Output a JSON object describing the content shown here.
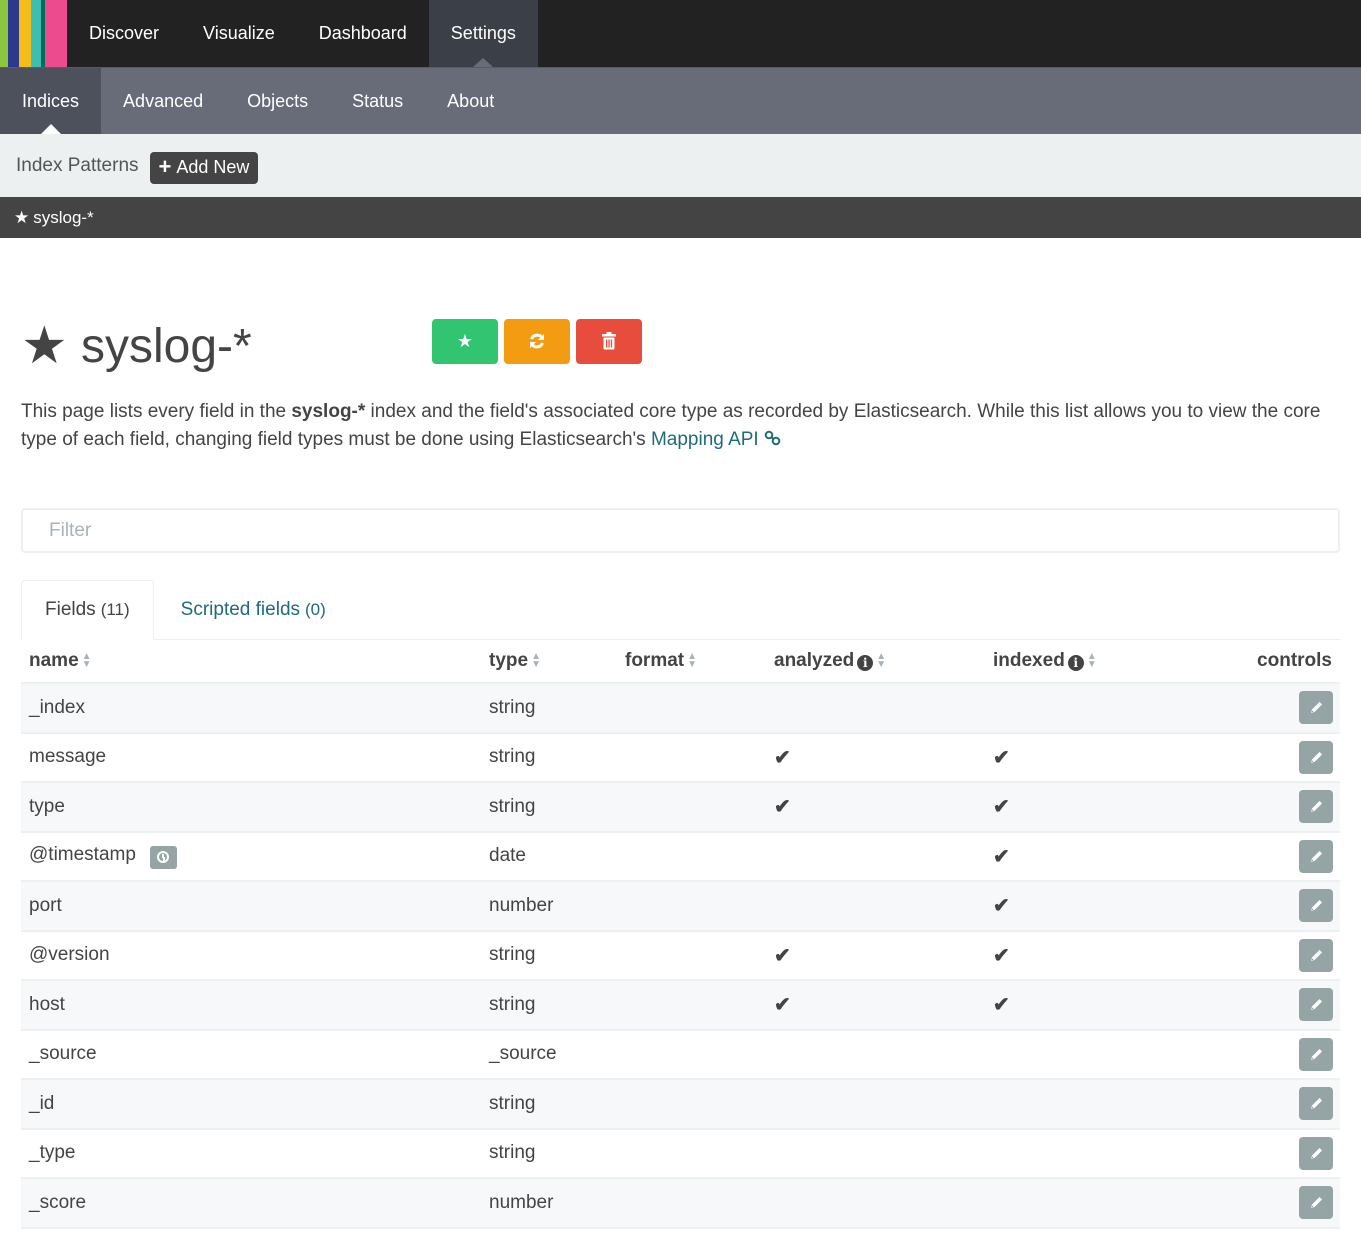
{
  "logo": {
    "colors": [
      "#8cc63f",
      "#2b3a8c",
      "#f3bd19",
      "#3ebeb0",
      "#006b5b",
      "#ec4b8e"
    ]
  },
  "topnav": {
    "items": [
      {
        "label": "Discover",
        "active": false
      },
      {
        "label": "Visualize",
        "active": false
      },
      {
        "label": "Dashboard",
        "active": false
      },
      {
        "label": "Settings",
        "active": true
      }
    ]
  },
  "subnav": {
    "items": [
      {
        "label": "Indices",
        "active": true
      },
      {
        "label": "Advanced",
        "active": false
      },
      {
        "label": "Objects",
        "active": false
      },
      {
        "label": "Status",
        "active": false
      },
      {
        "label": "About",
        "active": false
      }
    ]
  },
  "patternbar": {
    "title": "Index Patterns",
    "add_label": "Add New"
  },
  "patternlist": {
    "items": [
      {
        "label": "syslog-*",
        "default": true
      }
    ]
  },
  "header": {
    "title": "syslog-*",
    "actions": [
      {
        "name": "set-default-button",
        "icon": "star-icon",
        "color": "#31c471"
      },
      {
        "name": "refresh-fields-button",
        "icon": "refresh-icon",
        "color": "#f39c12"
      },
      {
        "name": "delete-pattern-button",
        "icon": "trash-icon",
        "color": "#e74c3c"
      }
    ]
  },
  "description": {
    "part1": "This page lists every field in the ",
    "bold": "syslog-*",
    "part2": " index and the field's associated core type as recorded by Elasticsearch. While this list allows you to view the core type of each field, changing field types must be done using Elasticsearch's ",
    "link": "Mapping API"
  },
  "filter": {
    "placeholder": "Filter",
    "value": ""
  },
  "tabs": [
    {
      "label": "Fields",
      "count": "(11)",
      "active": true
    },
    {
      "label": "Scripted fields",
      "count": "(0)",
      "active": false
    }
  ],
  "table": {
    "columns": [
      "name",
      "type",
      "format",
      "analyzed",
      "indexed",
      "controls"
    ],
    "rows": [
      {
        "name": "_index",
        "type": "string",
        "format": "",
        "analyzed": false,
        "indexed": false,
        "timefield": false
      },
      {
        "name": "message",
        "type": "string",
        "format": "",
        "analyzed": true,
        "indexed": true,
        "timefield": false
      },
      {
        "name": "type",
        "type": "string",
        "format": "",
        "analyzed": true,
        "indexed": true,
        "timefield": false
      },
      {
        "name": "@timestamp",
        "type": "date",
        "format": "",
        "analyzed": false,
        "indexed": true,
        "timefield": true
      },
      {
        "name": "port",
        "type": "number",
        "format": "",
        "analyzed": false,
        "indexed": true,
        "timefield": false
      },
      {
        "name": "@version",
        "type": "string",
        "format": "",
        "analyzed": true,
        "indexed": true,
        "timefield": false
      },
      {
        "name": "host",
        "type": "string",
        "format": "",
        "analyzed": true,
        "indexed": true,
        "timefield": false
      },
      {
        "name": "_source",
        "type": "_source",
        "format": "",
        "analyzed": false,
        "indexed": false,
        "timefield": false
      },
      {
        "name": "_id",
        "type": "string",
        "format": "",
        "analyzed": false,
        "indexed": false,
        "timefield": false
      },
      {
        "name": "_type",
        "type": "string",
        "format": "",
        "analyzed": false,
        "indexed": false,
        "timefield": false
      },
      {
        "name": "_score",
        "type": "number",
        "format": "",
        "analyzed": false,
        "indexed": false,
        "timefield": false
      }
    ]
  }
}
